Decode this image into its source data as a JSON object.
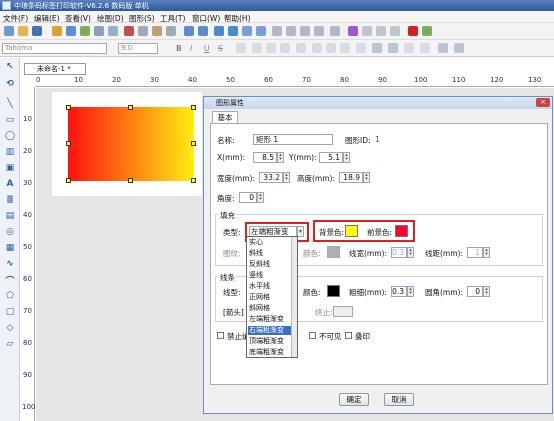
{
  "app": {
    "title": "中琅条码标签打印软件-V6.2.6 数码版 单机"
  },
  "menu": [
    "文件(F)",
    "编辑(E)",
    "查看(V)",
    "绘图(D)",
    "图形(S)",
    "工具(T)",
    "窗口(W)",
    "帮助(H)"
  ],
  "toolbar2": {
    "font": "Tahoma",
    "size": "9.0",
    "style_buttons": [
      "B",
      "I",
      "U",
      "S"
    ]
  },
  "document": {
    "tab": "未命名-1 *"
  },
  "ruler": {
    "h": [
      "0",
      "10",
      "20",
      "30",
      "40",
      "50",
      "60",
      "70",
      "80",
      "90",
      "100",
      "110",
      "120",
      "130"
    ],
    "v": [
      "10",
      "20",
      "30",
      "40",
      "50",
      "60",
      "70",
      "80",
      "90",
      "100"
    ]
  },
  "dialog": {
    "title": "图形属性",
    "close": "×",
    "tab": "基本",
    "name_label": "名称:",
    "name_value": "矩形 1",
    "id_label": "图形ID:",
    "id_value": "1",
    "x_label": "X(mm):",
    "x_value": "8.5",
    "y_label": "Y(mm):",
    "y_value": "5.1",
    "w_label": "宽度(mm):",
    "w_value": "33.2",
    "h_label": "高度(mm):",
    "h_value": "18.9",
    "angle_label": "角度:",
    "angle_value": "0",
    "fill_group": "填充",
    "type_label": "类型:",
    "type_value": "左端粗渐变",
    "bg_label": "背景色:",
    "fg_label": "前景色:",
    "bg_color": "#ffff00",
    "fg_color": "#ff0033",
    "pattern_label": "图纹:",
    "color_label": "颜色:",
    "linewidth_label": "线宽(mm):",
    "linewidth_value": "0.3",
    "linedist_label": "线距(mm):",
    "linedist_value": "1",
    "line_group": "线条",
    "linetype_label": "线型:",
    "line_color_label": "颜色:",
    "line_color": "#000000",
    "thickness_label": "粗细(mm):",
    "thickness_value": "0.3",
    "corner_label": "圆角(mm):",
    "corner_value": "0",
    "arrow_label": "[箭头]",
    "end_label": "终止:",
    "checks": [
      "禁止编辑",
      "不可见",
      "叠印"
    ],
    "ok": "确定",
    "cancel": "取消"
  },
  "dropdown": {
    "options": [
      "实心",
      "斜线",
      "反斜线",
      "竖线",
      "水平线",
      "正网格",
      "斜网格",
      "左端粗渐变",
      "右端粗渐变",
      "顶端粗渐变",
      "底端粗渐变"
    ],
    "selected_index": 8
  },
  "colors": {
    "accent": "#2c5aa0",
    "highlight": "#e02020",
    "selection": "#3a6fc4"
  }
}
